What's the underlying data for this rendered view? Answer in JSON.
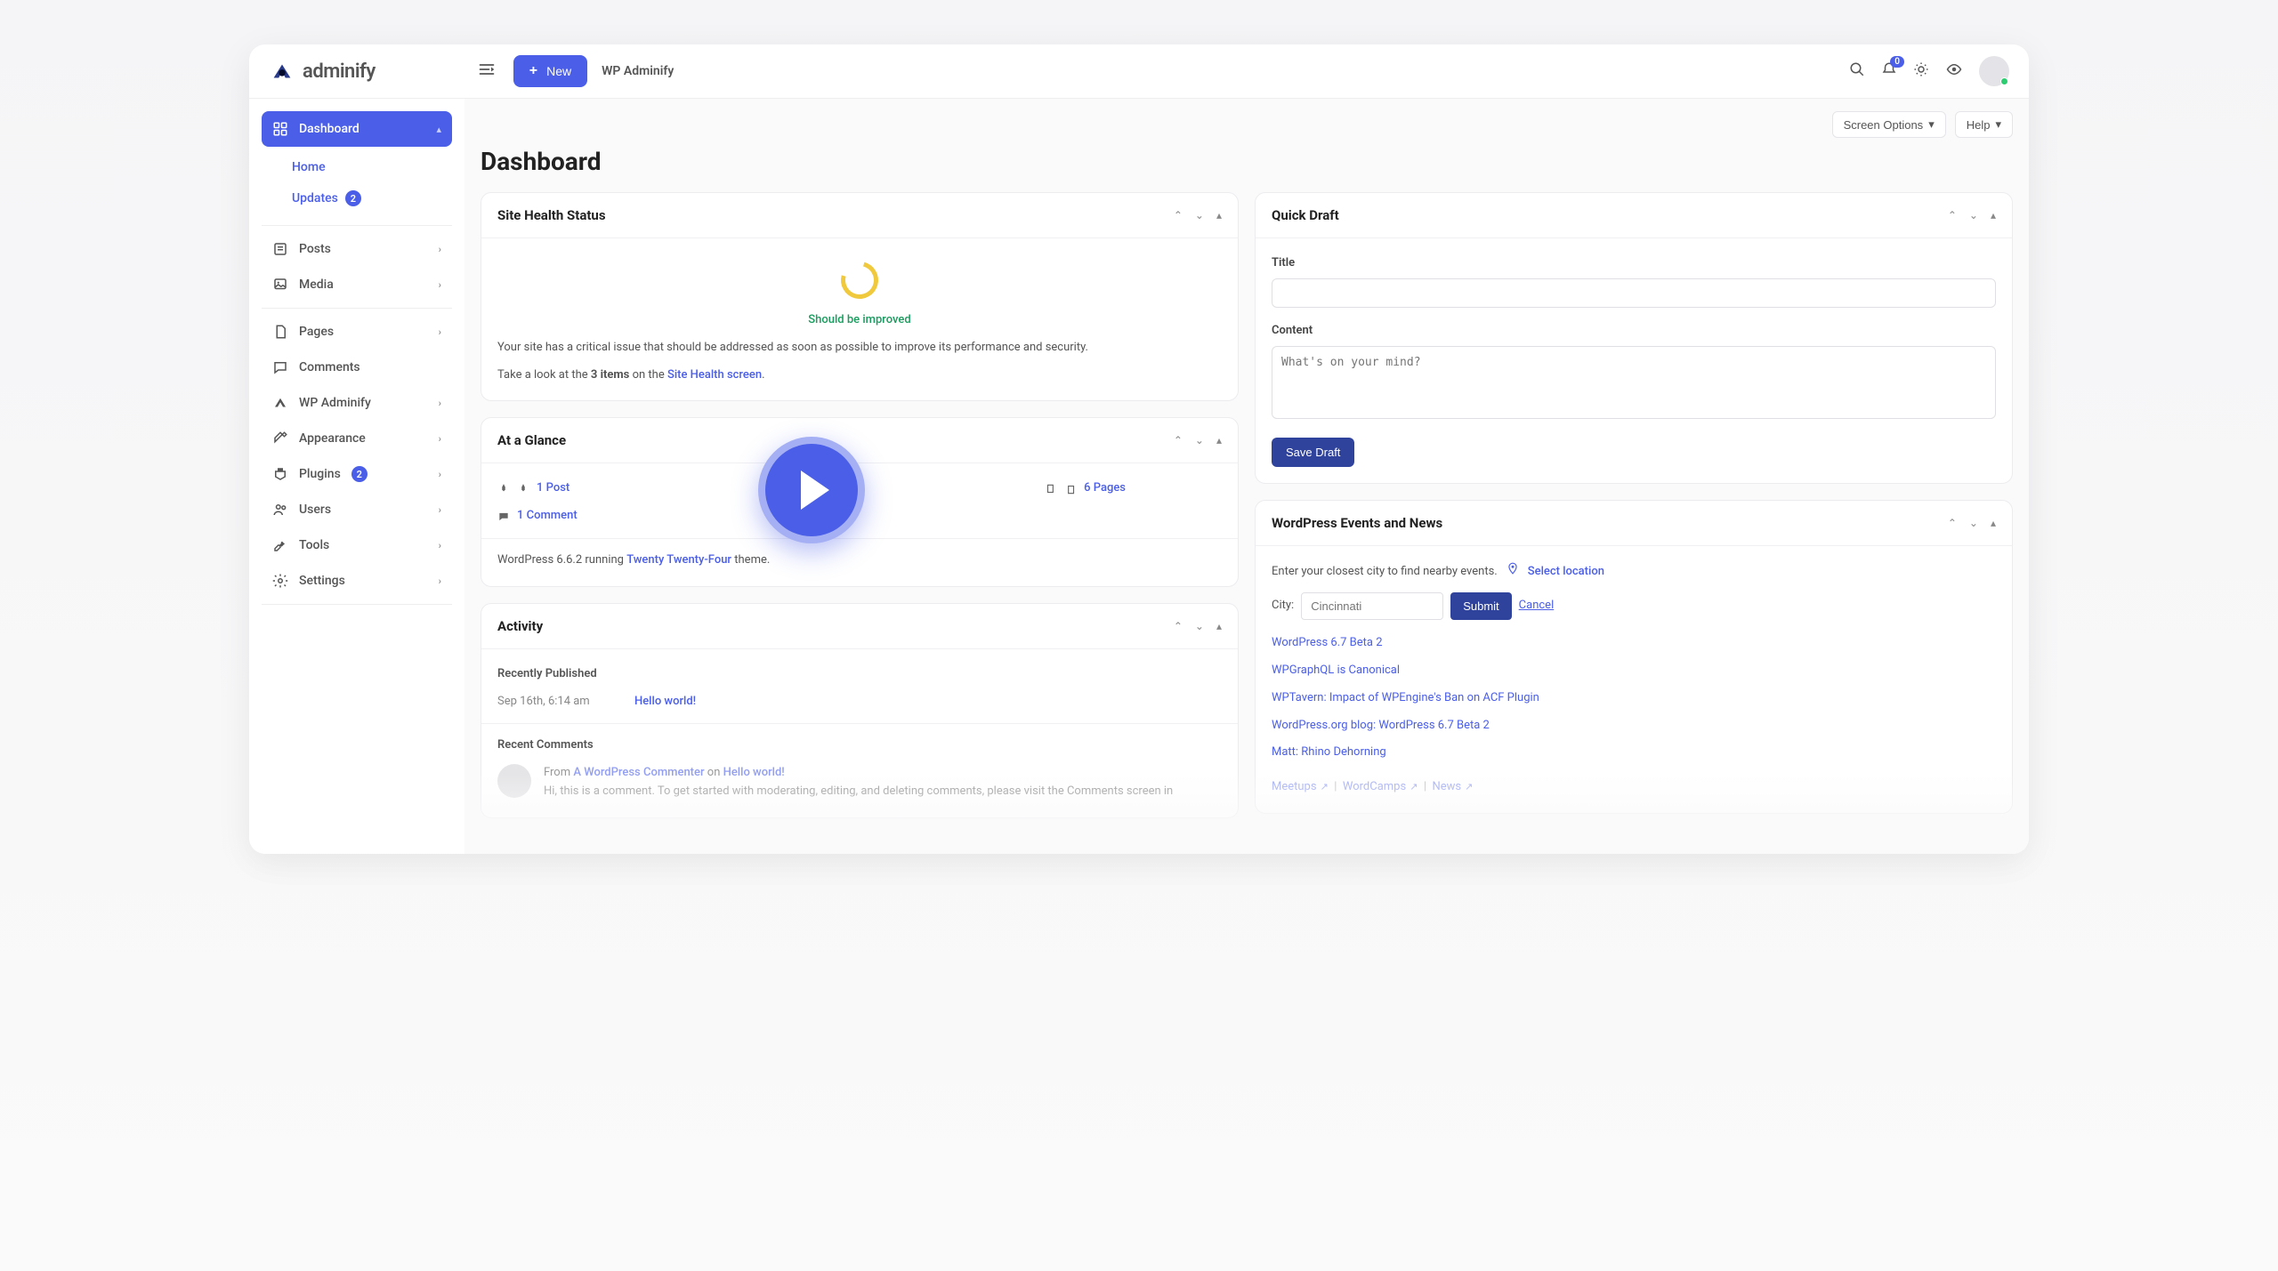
{
  "brand": {
    "name": "adminify"
  },
  "topbar": {
    "new_label": "New",
    "app_label": "WP Adminify",
    "notif_count": "0"
  },
  "controls": {
    "screen_options": "Screen Options",
    "help": "Help"
  },
  "sidebar": {
    "dashboard": {
      "label": "Dashboard"
    },
    "home": {
      "label": "Home"
    },
    "updates": {
      "label": "Updates",
      "badge": "2"
    },
    "posts": {
      "label": "Posts"
    },
    "media": {
      "label": "Media"
    },
    "pages": {
      "label": "Pages"
    },
    "comments": {
      "label": "Comments"
    },
    "wp_adminify": {
      "label": "WP Adminify"
    },
    "appearance": {
      "label": "Appearance"
    },
    "plugins": {
      "label": "Plugins",
      "badge": "2"
    },
    "users": {
      "label": "Users"
    },
    "tools": {
      "label": "Tools"
    },
    "settings": {
      "label": "Settings"
    }
  },
  "page": {
    "title": "Dashboard"
  },
  "panels": {
    "site_health": {
      "title": "Site Health Status",
      "status": "Should be improved",
      "body1": "Your site has a critical issue that should be addressed as soon as possible to improve its performance and security.",
      "body2_a": "Take a look at the ",
      "body2_b": "3 items",
      "body2_c": " on the ",
      "body2_link": "Site Health screen",
      "body2_d": "."
    },
    "glance": {
      "title": "At a Glance",
      "post": "1 Post",
      "pages": "6 Pages",
      "comment": "1 Comment",
      "foot_a": "WordPress 6.6.2 running ",
      "foot_link": "Twenty Twenty-Four",
      "foot_b": " theme."
    },
    "activity": {
      "title": "Activity",
      "recent_pub": "Recently Published",
      "item1_time": "Sep 16th, 6:14 am",
      "item1_title": "Hello world!",
      "recent_com": "Recent Comments",
      "com_from": "From ",
      "com_author": "A WordPress Commenter",
      "com_on": " on ",
      "com_post": "Hello world!",
      "com_body": "Hi, this is a comment. To get started with moderating, editing, and deleting comments, please visit the Comments screen in"
    },
    "draft": {
      "title": "Quick Draft",
      "title_label": "Title",
      "content_label": "Content",
      "placeholder": "What's on your mind?",
      "save": "Save Draft"
    },
    "events": {
      "title": "WordPress Events and News",
      "instruct": "Enter your closest city to find nearby events.",
      "select_loc": "Select location",
      "city_label": "City:",
      "city_placeholder": "Cincinnati",
      "submit": "Submit",
      "cancel": "Cancel",
      "news": [
        "WordPress 6.7 Beta 2",
        "WPGraphQL is Canonical",
        "WPTavern: Impact of WPEngine's Ban on ACF Plugin",
        "WordPress.org blog: WordPress 6.7 Beta 2",
        "Matt: Rhino Dehorning"
      ],
      "footer_meetups": "Meetups",
      "footer_wordcamps": "WordCamps",
      "footer_news": "News"
    }
  }
}
